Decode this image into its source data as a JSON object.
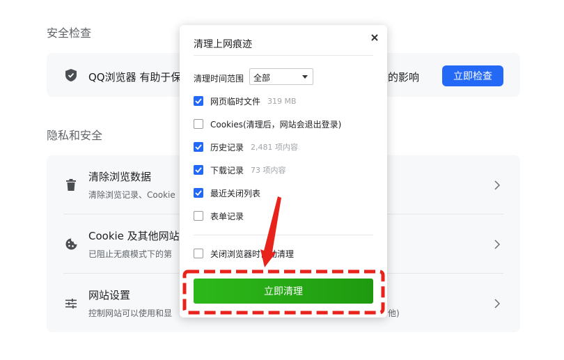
{
  "security": {
    "title": "安全检查",
    "desc_visible": "QQ浏览器 有助于保",
    "desc_tail": "的影响",
    "check_button": "立即检查"
  },
  "privacy": {
    "title": "隐私和安全",
    "items": [
      {
        "title": "清除浏览数据",
        "subtitle": "清除浏览记录、Cookie",
        "icon": "trash-icon"
      },
      {
        "title": "Cookie 及其他网站",
        "subtitle": "已阻止无痕模式下的第",
        "icon": "cookie-icon"
      },
      {
        "title": "网站设置",
        "subtitle": "控制网站可以使用和显",
        "subtitle_tail": "他)",
        "icon": "sliders-icon"
      }
    ]
  },
  "dialog": {
    "title": "清理上网痕迹",
    "range_label": "清理时间范围",
    "range_value": "全部",
    "options": [
      {
        "label": "网页临时文件",
        "meta": "319 MB",
        "checked": true
      },
      {
        "label": "Cookies(清理后，网站会退出登录)",
        "meta": "",
        "checked": false
      },
      {
        "label": "历史记录",
        "meta": "2,481 项内容",
        "checked": true
      },
      {
        "label": "下载记录",
        "meta": "73 项内容",
        "checked": true
      },
      {
        "label": "最近关闭列表",
        "meta": "",
        "checked": true
      },
      {
        "label": "表单记录",
        "meta": "",
        "checked": false
      }
    ],
    "auto_clean": {
      "label": "关闭浏览器时自动清理",
      "checked": false
    },
    "clean_button": "立即清理"
  },
  "colors": {
    "accent": "#2469f5",
    "clean": "#26a814",
    "annotation": "#e8231c"
  }
}
